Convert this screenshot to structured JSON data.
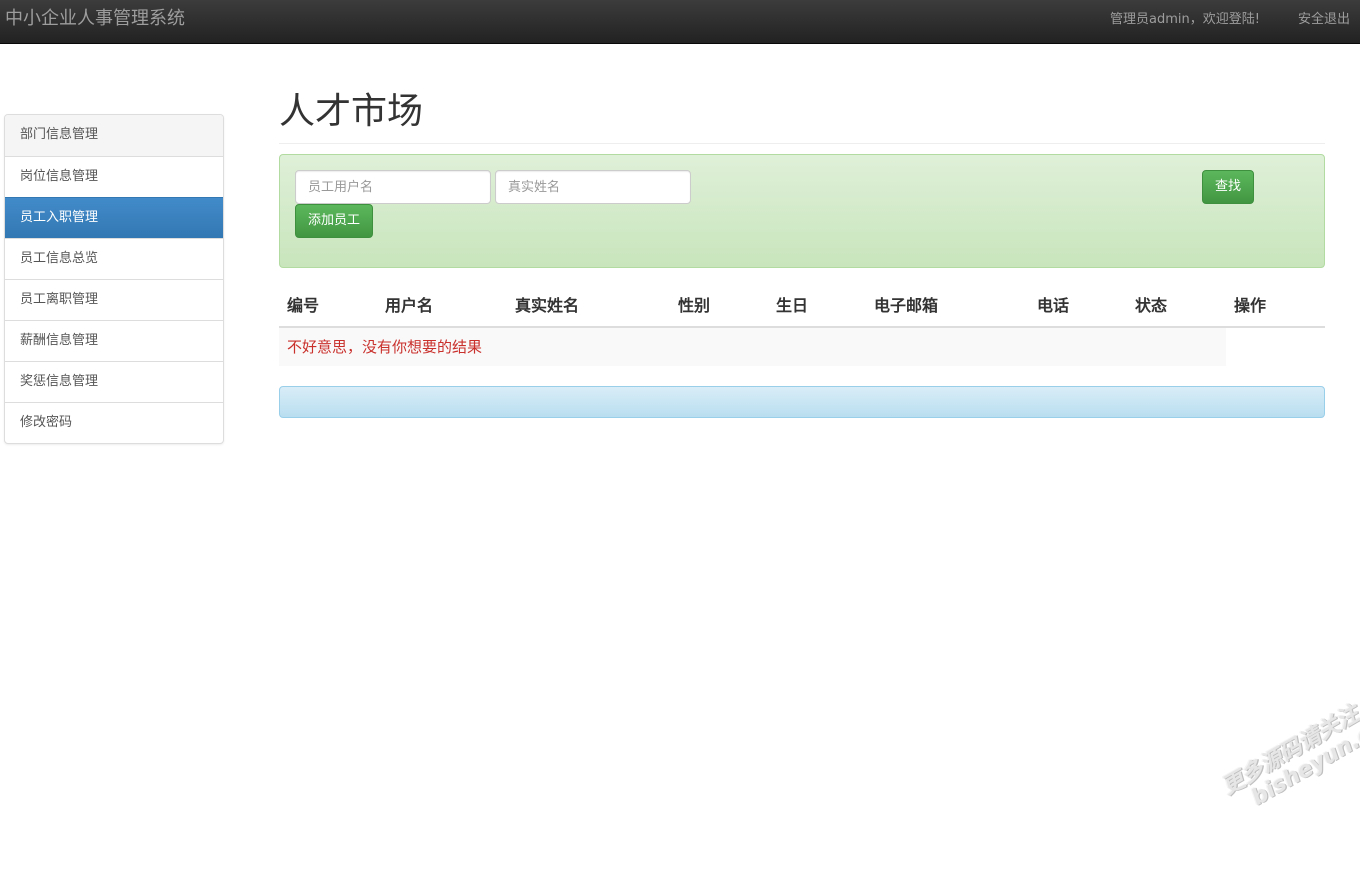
{
  "navbar": {
    "brand": "中小企业人事管理系统",
    "welcome": "管理员admin，欢迎登陆!",
    "logout": "安全退出"
  },
  "sidebar": {
    "items": [
      {
        "label": "部门信息管理"
      },
      {
        "label": "岗位信息管理"
      },
      {
        "label": "员工入职管理"
      },
      {
        "label": "员工信息总览"
      },
      {
        "label": "员工离职管理"
      },
      {
        "label": "薪酬信息管理"
      },
      {
        "label": "奖惩信息管理"
      },
      {
        "label": "修改密码"
      }
    ],
    "active_index": 2
  },
  "main": {
    "title": "人才市场",
    "search": {
      "username_placeholder": "员工用户名",
      "realname_placeholder": "真实姓名",
      "search_label": "查找",
      "add_label": "添加员工"
    },
    "table": {
      "headers": [
        "编号",
        "用户名",
        "真实姓名",
        "性别",
        "生日",
        "电子邮箱",
        "电话",
        "状态",
        "操作"
      ],
      "empty_message": "不好意思，没有你想要的结果"
    }
  },
  "watermark": {
    "line1": "更多源码请关注",
    "line2": "bisheyun.org"
  }
}
